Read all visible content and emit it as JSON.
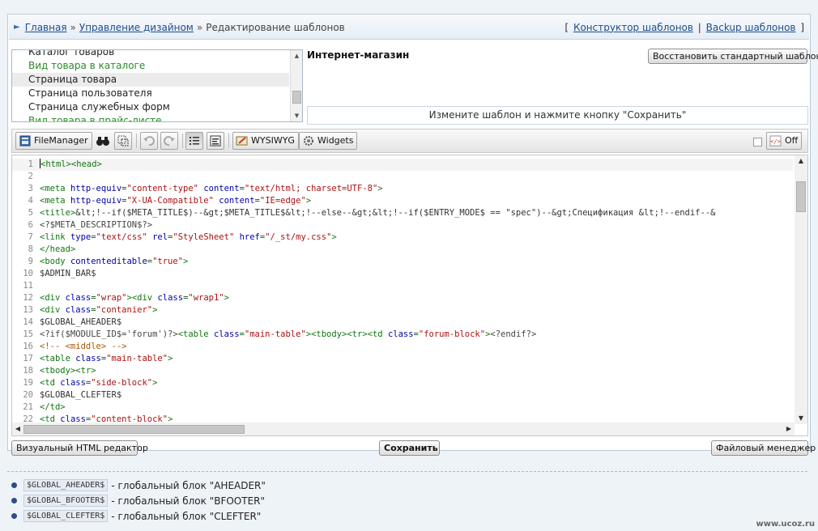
{
  "breadcrumb": {
    "home": "Главная",
    "sep": "»",
    "design": "Управление дизайном",
    "current": "Редактирование шаблонов",
    "right_open": "[",
    "constructor": "Конструктор шаблонов",
    "pipe": "|",
    "backup": "Backup шаблонов",
    "right_close": "]"
  },
  "template_list": {
    "items": [
      {
        "label": "Каталог товаров",
        "style": "normal"
      },
      {
        "label": "Вид товара в каталоге",
        "style": "green"
      },
      {
        "label": "Страница товара",
        "style": "selected"
      },
      {
        "label": "Страница пользователя",
        "style": "normal"
      },
      {
        "label": "Страница служебных форм",
        "style": "normal"
      },
      {
        "label": "Вид товара в прайс-листе",
        "style": "green"
      }
    ]
  },
  "panel": {
    "shop_name": "Интернет-магазин",
    "restore_label": "Восстановить стандартный шаблон",
    "hint": "Измените шаблон и нажмите кнопку \"Сохранить\""
  },
  "toolbar": {
    "filemanager": "FileManager",
    "wysiwyg": "WYSIWYG",
    "widgets": "Widgets",
    "off": "Off"
  },
  "editor": {
    "lines": [
      "<html><head>",
      "",
      "<meta http-equiv=\"content-type\" content=\"text/html; charset=UTF-8\">",
      "<meta http-equiv=\"X-UA-Compatible\" content=\"IE=edge\">",
      "<title>&lt;!--if($META_TITLE$)--&gt;$META_TITLE$&lt;!--else--&gt;&lt;!--if($ENTRY_MODE$ == \"spec\")--&gt;Спецификация &lt;!--endif--&",
      "<?$META_DESCRIPTION$?>",
      "<link type=\"text/css\" rel=\"StyleSheet\" href=\"/_st/my.css\">",
      "</head>",
      "<body contenteditable=\"true\">",
      "$ADMIN_BAR$",
      "",
      "<div class=\"wrap\"><div class=\"wrap1\">",
      "<div class=\"contanier\">",
      "$GLOBAL_AHEADER$",
      "<?if($MODULE_ID$='forum')?><table class=\"main-table\"><tbody><tr><td class=\"forum-block\"><?endif?>",
      "<!-- <middle> -->",
      "<table class=\"main-table\">",
      "<tbody><tr>",
      "<td class=\"side-block\">",
      "$GLOBAL_CLEFTER$",
      "</td>",
      "<td class=\"content-block\">"
    ]
  },
  "actions": {
    "visual": "Визуальный HTML редактор",
    "save": "Сохранить",
    "filemanager": "Файловый менеджер"
  },
  "legend": [
    {
      "tag": "$GLOBAL_AHEADER$",
      "text": "- глобальный блок \"AHEADER\""
    },
    {
      "tag": "$GLOBAL_BFOOTER$",
      "text": "- глобальный блок \"BFOOTER\""
    },
    {
      "tag": "$GLOBAL_CLEFTER$",
      "text": "- глобальный блок \"CLEFTER\""
    }
  ],
  "watermark": "www.ucoz.ru"
}
